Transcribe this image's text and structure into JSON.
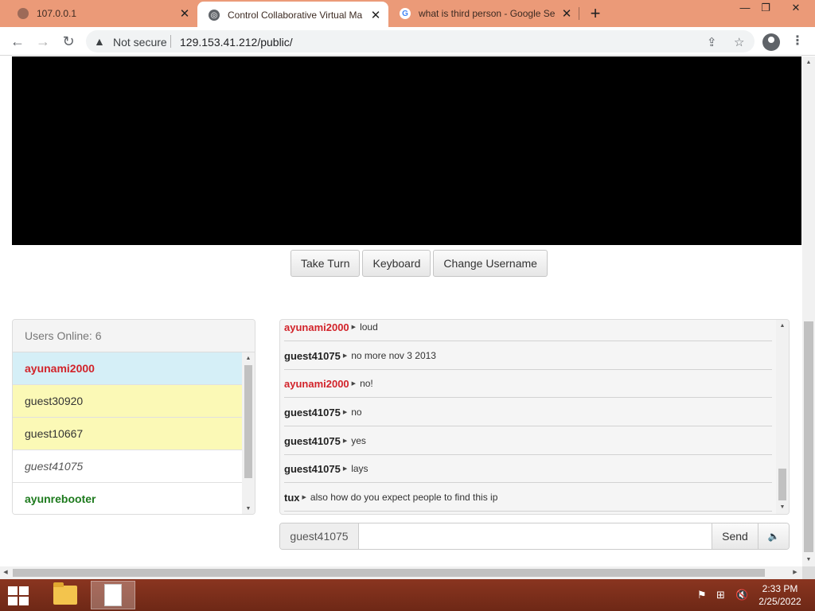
{
  "browser": {
    "tabs": [
      {
        "title": "107.0.0.1",
        "active": false,
        "icon": "globe-icon"
      },
      {
        "title": "Control Collaborative Virtual Ma",
        "active": true,
        "icon": "globe-icon"
      },
      {
        "title": "what is third person - Google Se",
        "active": false,
        "icon": "google-icon"
      }
    ],
    "new_tab_label": "+",
    "window_controls": [
      "minimize",
      "restore",
      "close"
    ],
    "security_label": "Not secure",
    "url": "129.153.41.212/public/"
  },
  "page": {
    "buttons": {
      "take_turn": "Take Turn",
      "keyboard": "Keyboard",
      "change_username": "Change Username"
    },
    "users_panel": {
      "header": "Users Online: 6",
      "users": [
        {
          "name": "ayunami2000",
          "style": "red-bold",
          "bg": "blue"
        },
        {
          "name": "guest30920",
          "style": "plain",
          "bg": "yellow"
        },
        {
          "name": "guest10667",
          "style": "plain",
          "bg": "yellow"
        },
        {
          "name": "guest41075",
          "style": "italic",
          "bg": "white"
        },
        {
          "name": "ayunrebooter",
          "style": "green-bold",
          "bg": "white"
        }
      ]
    },
    "chat": {
      "messages": [
        {
          "user": "ayunami2000",
          "text": "loud",
          "color": "red"
        },
        {
          "user": "guest41075",
          "text": "no more nov 3 2013",
          "color": "black"
        },
        {
          "user": "ayunami2000",
          "text": "no!",
          "color": "red"
        },
        {
          "user": "guest41075",
          "text": "no",
          "color": "black"
        },
        {
          "user": "guest41075",
          "text": "yes",
          "color": "black"
        },
        {
          "user": "guest41075",
          "text": "lays",
          "color": "black"
        },
        {
          "user": "tux",
          "text": "also how do you expect people to find this ip",
          "color": "black"
        }
      ],
      "input_username": "guest41075",
      "input_value": "",
      "send_label": "Send"
    }
  },
  "taskbar": {
    "time": "2:33 PM",
    "date": "2/25/2022"
  },
  "colors": {
    "tab_strip": "#eb9a78",
    "taskbar": "#7c2d1a",
    "user_red": "#d2232a",
    "user_green": "#1d7a1d",
    "row_blue": "#d5eff7",
    "row_yellow": "#fbf9b6"
  }
}
